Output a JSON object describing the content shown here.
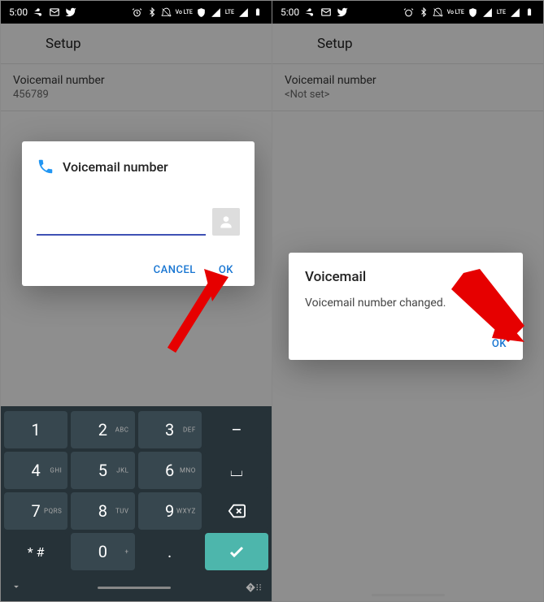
{
  "status": {
    "time": "5:00",
    "lte": "LTE",
    "volte": "Vo LTE"
  },
  "left": {
    "header": "Setup",
    "setting_title": "Voicemail number",
    "setting_value": "456789",
    "dialog": {
      "title": "Voicemail number",
      "input_value": "",
      "cancel": "CANCEL",
      "ok": "OK"
    },
    "keyboard": {
      "keys": [
        [
          {
            "n": "1",
            "s": ""
          },
          {
            "n": "2",
            "s": "ABC"
          },
          {
            "n": "3",
            "s": "DEF"
          },
          {
            "n": "–",
            "s": ""
          }
        ],
        [
          {
            "n": "4",
            "s": "GHI"
          },
          {
            "n": "5",
            "s": "JKL"
          },
          {
            "n": "6",
            "s": "MNO"
          },
          {
            "n": "⌴",
            "s": ""
          }
        ],
        [
          {
            "n": "7",
            "s": "PQRS"
          },
          {
            "n": "8",
            "s": "TUV"
          },
          {
            "n": "9",
            "s": "WXYZ"
          },
          {
            "n": "⌫",
            "s": ""
          }
        ],
        [
          {
            "n": "* #",
            "s": ""
          },
          {
            "n": "0",
            "s": "+"
          },
          {
            "n": ".",
            "s": ""
          },
          {
            "n": "✓",
            "s": ""
          }
        ]
      ]
    }
  },
  "right": {
    "header": "Setup",
    "setting_title": "Voicemail number",
    "setting_value": "<Not set>",
    "dialog": {
      "title": "Voicemail",
      "message": "Voicemail number changed.",
      "ok": "OK"
    }
  }
}
